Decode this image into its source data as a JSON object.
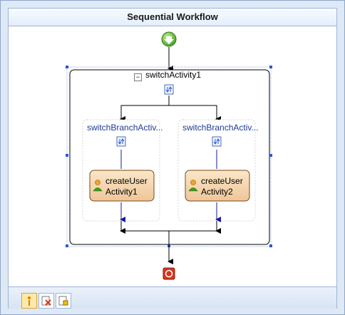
{
  "designer": {
    "title": "Sequential Workflow"
  },
  "switch": {
    "label": "switchActivity1",
    "collapse_symbol": "−"
  },
  "branches": [
    {
      "label": "switchBranchActiv...",
      "activity": {
        "line1": "createUser",
        "line2": "Activity1"
      }
    },
    {
      "label": "switchBranchActiv...",
      "activity": {
        "line1": "createUser",
        "line2": "Activity2"
      }
    }
  ],
  "bottom_tabs": [
    {
      "name": "view-workflow-tab",
      "active": true
    },
    {
      "name": "view-cancel-handler-tab",
      "active": false
    },
    {
      "name": "view-fault-handlers-tab",
      "active": false
    }
  ],
  "colors": {
    "start": "#4caf2a",
    "stop": "#d9341c",
    "activity_fill": "#f3d6ad",
    "activity_border": "#7a4a1a",
    "selection_handle": "#2a58d6",
    "branch_arrow": "#1a1a9c"
  }
}
